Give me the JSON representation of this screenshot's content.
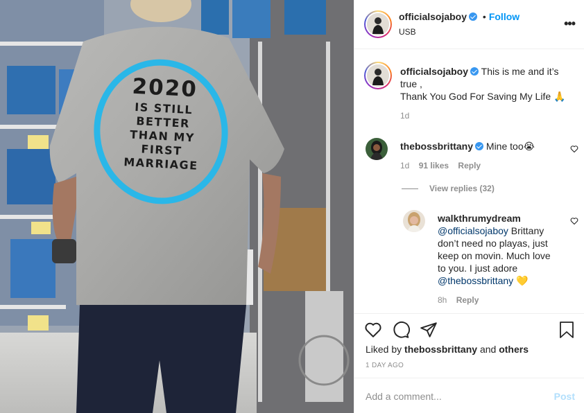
{
  "post": {
    "username": "officialsojaboy",
    "follow_label": "Follow",
    "dot": "•",
    "location": "USB",
    "more_icon": "more-horizontal-icon"
  },
  "photo": {
    "shirt_year": "2020",
    "shirt_lines": "IS STILL\nBETTER\nTHAN MY\nFIRST\nMARRIAGE",
    "circle_color": "#2ab7e8"
  },
  "caption": {
    "username": "officialsojaboy",
    "text_line1": "This is me and it’s",
    "text_line2": "true ,",
    "text_line3": "Thank You God For Saving My Life 🙏",
    "time": "1d"
  },
  "comments": [
    {
      "username": "thebossbrittany",
      "text": "Mine too😭",
      "time": "1d",
      "likes": "91 likes",
      "reply_label": "Reply"
    }
  ],
  "view_replies": "View replies (32)",
  "reply": {
    "username": "walkthrumydream",
    "mention1": "@officialsojaboy",
    "text1": " Brittany",
    "text2": "don’t need no playas, just",
    "text3": "keep on movin. Much love",
    "text4": "to you. I just adore",
    "mention2": "@thebossbrittany",
    "emoji": " 💛",
    "time": "8h",
    "reply_label": "Reply"
  },
  "actions": {
    "liked_prefix": "Liked by ",
    "liked_user": "thebossbrittany",
    "liked_mid": " and ",
    "liked_others": "others",
    "time_ago": "1 DAY AGO"
  },
  "comment_bar": {
    "placeholder": "Add a comment...",
    "post_label": "Post"
  },
  "colors": {
    "accent": "#0095f6",
    "verified": "#3897f0",
    "post_disabled": "#b2dffc",
    "muted": "#8e8e8e"
  }
}
